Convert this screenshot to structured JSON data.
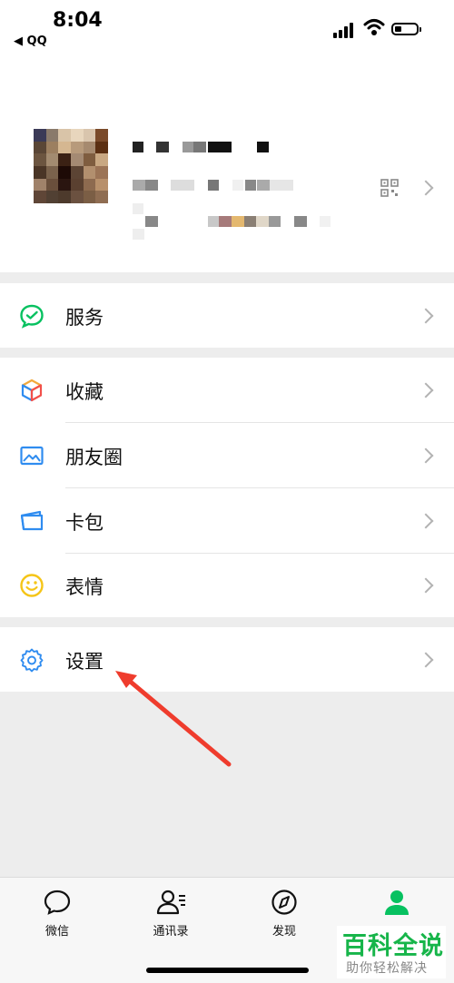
{
  "status_bar": {
    "time": "8:04",
    "back_app": "◀ QQ"
  },
  "menu": {
    "services": "服务",
    "favorites": "收藏",
    "moments": "朋友圈",
    "cards": "卡包",
    "stickers": "表情",
    "settings": "设置"
  },
  "tabs": [
    {
      "label": "微信",
      "icon": "chat-bubble-icon"
    },
    {
      "label": "通讯录",
      "icon": "contacts-icon"
    },
    {
      "label": "发现",
      "icon": "compass-icon"
    },
    {
      "label": "",
      "icon": "me-person-icon",
      "active": true
    }
  ],
  "watermark": {
    "title": "百科全说",
    "subtitle": "助你轻松解决"
  },
  "colors": {
    "accent": "#07c160",
    "watermark_green": "#17b54a"
  }
}
